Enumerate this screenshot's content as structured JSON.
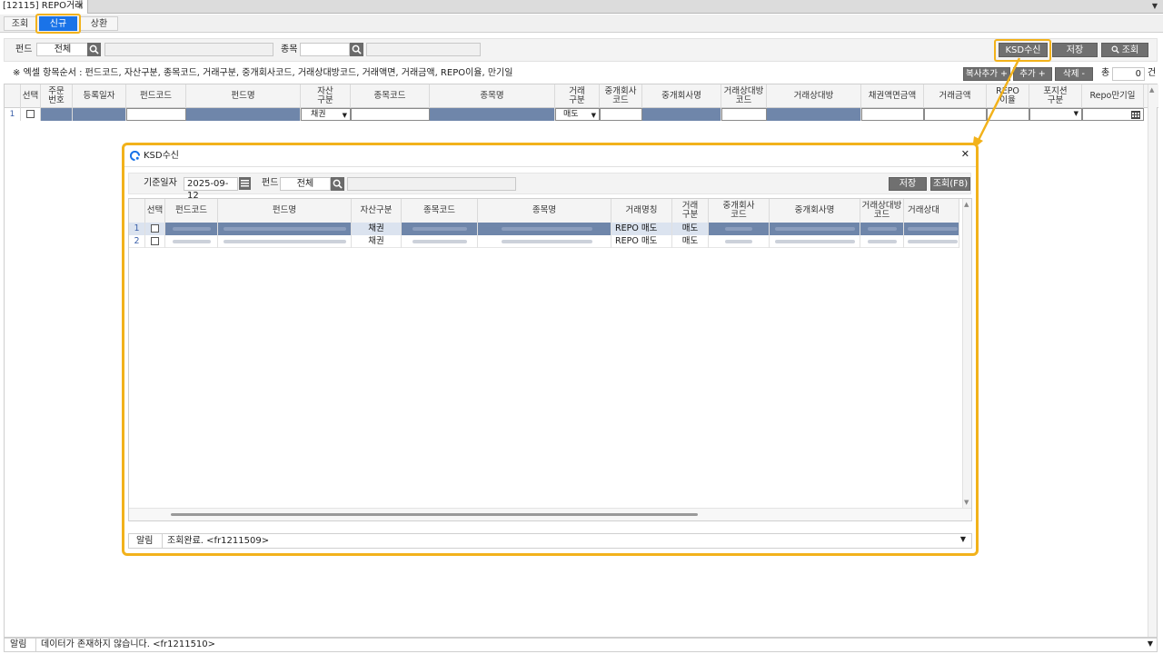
{
  "window_tab": {
    "title": "[12115] REPO거래",
    "close": "×",
    "dropdown": "▼"
  },
  "sub_tabs": [
    "조회",
    "신규",
    "상환"
  ],
  "active_sub_tab": "신규",
  "toolbar": {
    "fund_label": "펀드",
    "fund_value": "전체",
    "item_label": "종목",
    "ksd_button": "KSD수신",
    "save_button": "저장",
    "search_button": "조회",
    "search_icon_glyph": "🔍"
  },
  "notice": "※ 엑셀 항목순서 : 펀드코드, 자산구분, 종목코드, 거래구분, 중개회사코드, 거래상대방코드, 거래액면, 거래금액,  REPO이율, 만기일",
  "row_buttons": {
    "copy_add": "복사추가 +",
    "add": "추가 +",
    "delete": "삭제 -",
    "total_label": "총",
    "total_value": "0",
    "count_unit": "건"
  },
  "main_grid": {
    "headers": [
      "선택",
      "주문\n번호",
      "등록일자",
      "펀드코드",
      "펀드명",
      "자산\n구분",
      "종목코드",
      "종목명",
      "거래\n구분",
      "중개회사\n코드",
      "중개회사명",
      "거래상대방\n코드",
      "거래상대방",
      "채권액면금액",
      "거래금액",
      "REPO\n이율",
      "포지션\n구분",
      "Repo만기일"
    ],
    "row": {
      "num": "1",
      "asset_type": "채권",
      "trade_type": "매도"
    }
  },
  "status_bar": {
    "label": "알림",
    "message": "데이터가 존재하지 않습니다. <fr1211510>"
  },
  "modal": {
    "title": "KSD수신",
    "close": "✕",
    "base_date_label": "기준일자",
    "base_date_value": "2025-09-12",
    "fund_label": "펀드",
    "fund_value": "전체",
    "save_button": "저장",
    "search_button": "조회(F8)",
    "headers": [
      "선택",
      "펀드코드",
      "펀드명",
      "자산구분",
      "종목코드",
      "종목명",
      "거래명칭",
      "거래\n구분",
      "중개회사\n코드",
      "중개회사명",
      "거래상대방\n코드",
      "거래상대"
    ],
    "rows": [
      {
        "num": "1",
        "asset_type": "채권",
        "trade_name": "REPO 매도",
        "trade_type": "매도"
      },
      {
        "num": "2",
        "asset_type": "채권",
        "trade_name": "REPO 매도",
        "trade_type": "매도"
      }
    ],
    "status_label": "알림",
    "status_message": "조회완료. <fr1211509>"
  },
  "colors": {
    "accent": "#1a73e8",
    "highlight": "#f2b21b",
    "selected_row": "#6f86aa",
    "button": "#707070"
  }
}
